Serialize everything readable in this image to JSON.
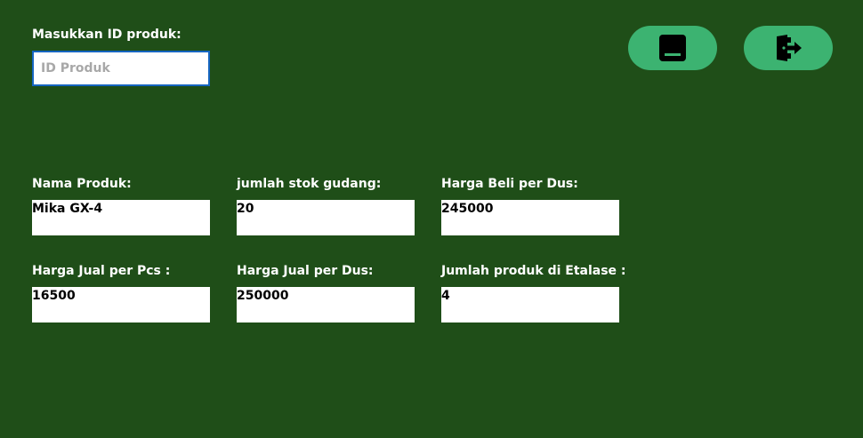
{
  "search": {
    "label": "Masukkan ID produk:",
    "placeholder": "ID Produk",
    "value": ""
  },
  "toolbar": {
    "buttons": [
      {
        "name": "minimize-button",
        "icon": "minimize-icon",
        "color": "#3cb371"
      },
      {
        "name": "exit-button",
        "icon": "exit-door-icon",
        "color": "#3cb371"
      }
    ]
  },
  "fields": {
    "nama_produk": {
      "label": "Nama Produk:",
      "value": "Mika GX-4"
    },
    "stok_gudang": {
      "label": "jumlah stok gudang:",
      "value": "20"
    },
    "harga_beli_dus": {
      "label": "Harga Beli per Dus:",
      "value": "245000"
    },
    "harga_jual_pcs": {
      "label": "Harga Jual per Pcs :",
      "value": "16500"
    },
    "harga_jual_dus": {
      "label": "Harga Jual per Dus:",
      "value": "250000"
    },
    "jumlah_etalase": {
      "label": "Jumlah produk di Etalase :",
      "value": "4"
    }
  },
  "colors": {
    "background": "#1f4e18",
    "button": "#3cb371",
    "input_border": "#1565c0"
  }
}
